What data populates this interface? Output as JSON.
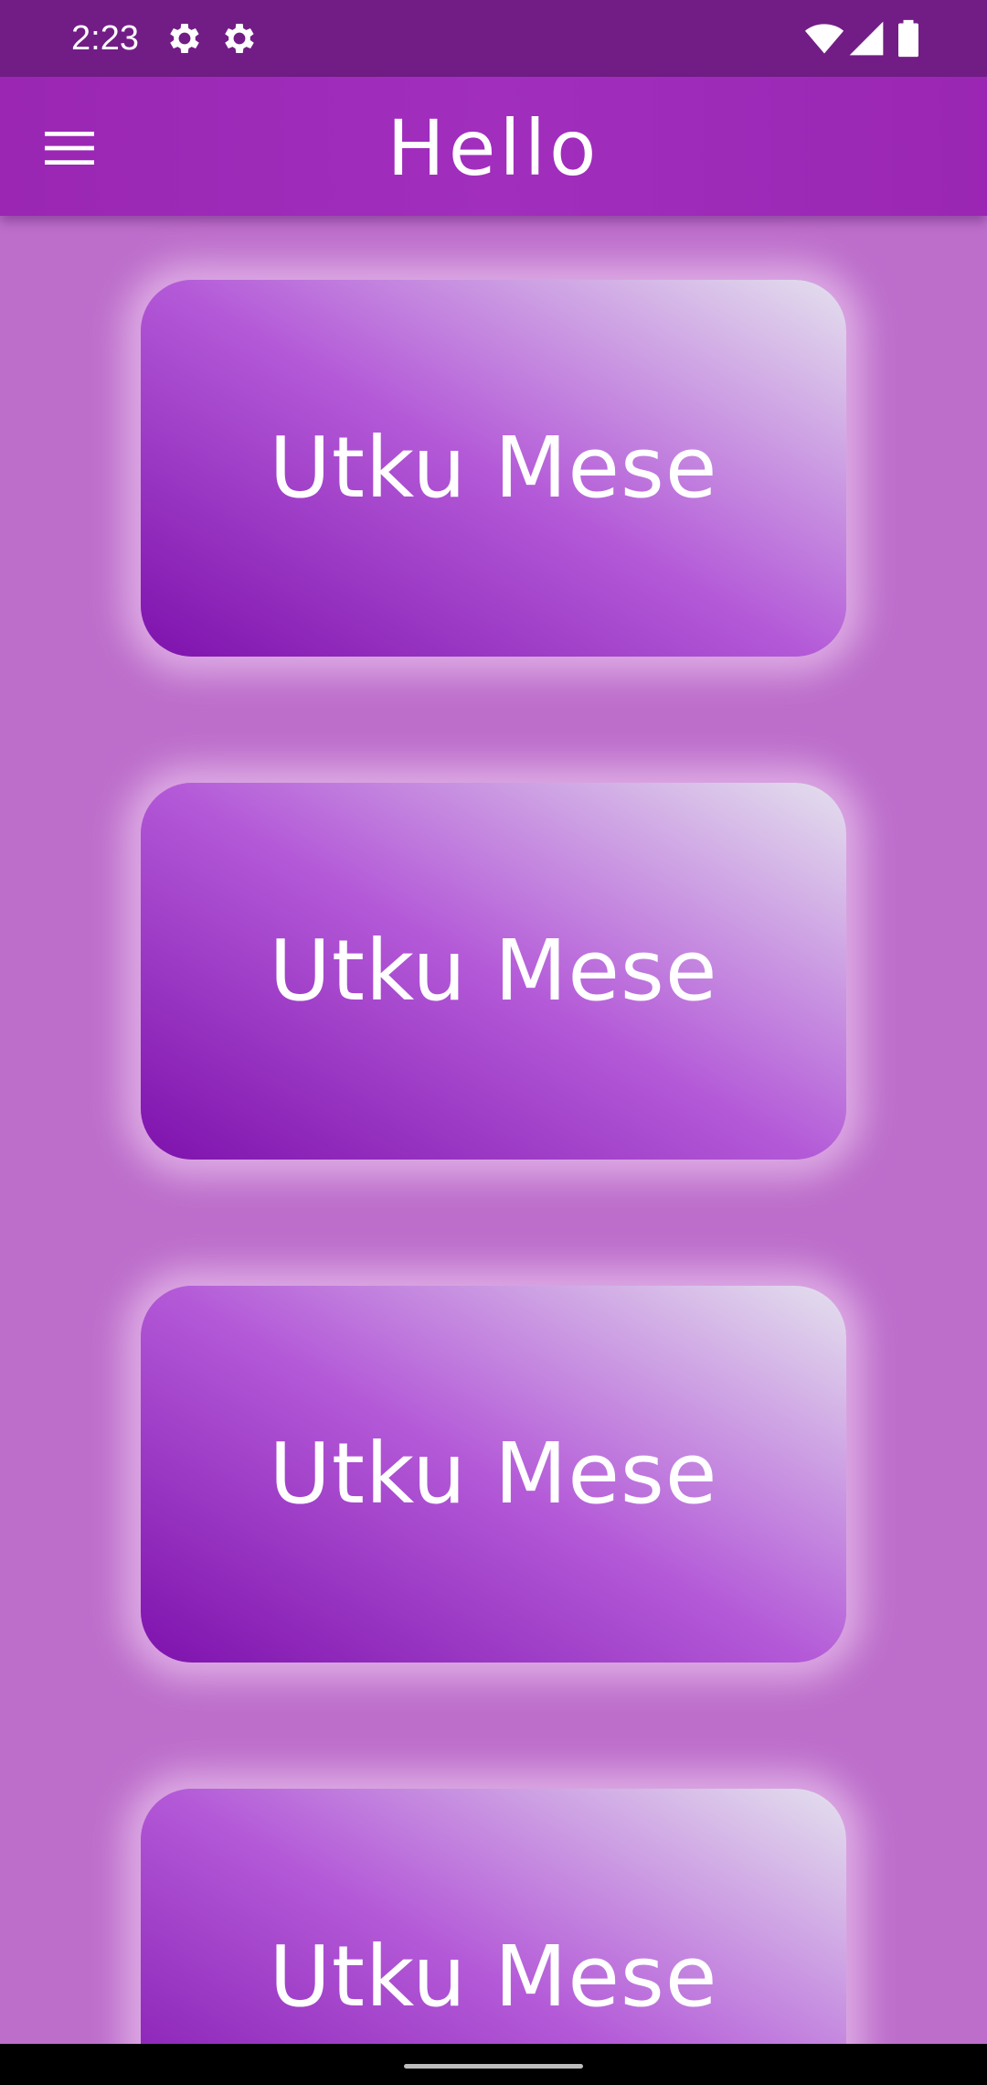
{
  "status_bar": {
    "time": "2:23",
    "left_icons": [
      "settings-gear-icon",
      "settings-gear-icon"
    ],
    "right_icons": [
      "wifi-icon",
      "cellular-signal-icon",
      "battery-icon"
    ]
  },
  "app_bar": {
    "title": "Hello",
    "menu_icon": "hamburger-menu-icon"
  },
  "cards": [
    {
      "label": "Utku Mese"
    },
    {
      "label": "Utku Mese"
    },
    {
      "label": "Utku Mese"
    },
    {
      "label": "Utku Mese"
    }
  ],
  "colors": {
    "status_bar": "#721d86",
    "app_bar": "#9a26b3",
    "background": "#bd6ecb",
    "card_gradient_start": "#7e12ad",
    "card_gradient_end": "#e4e0ee"
  }
}
